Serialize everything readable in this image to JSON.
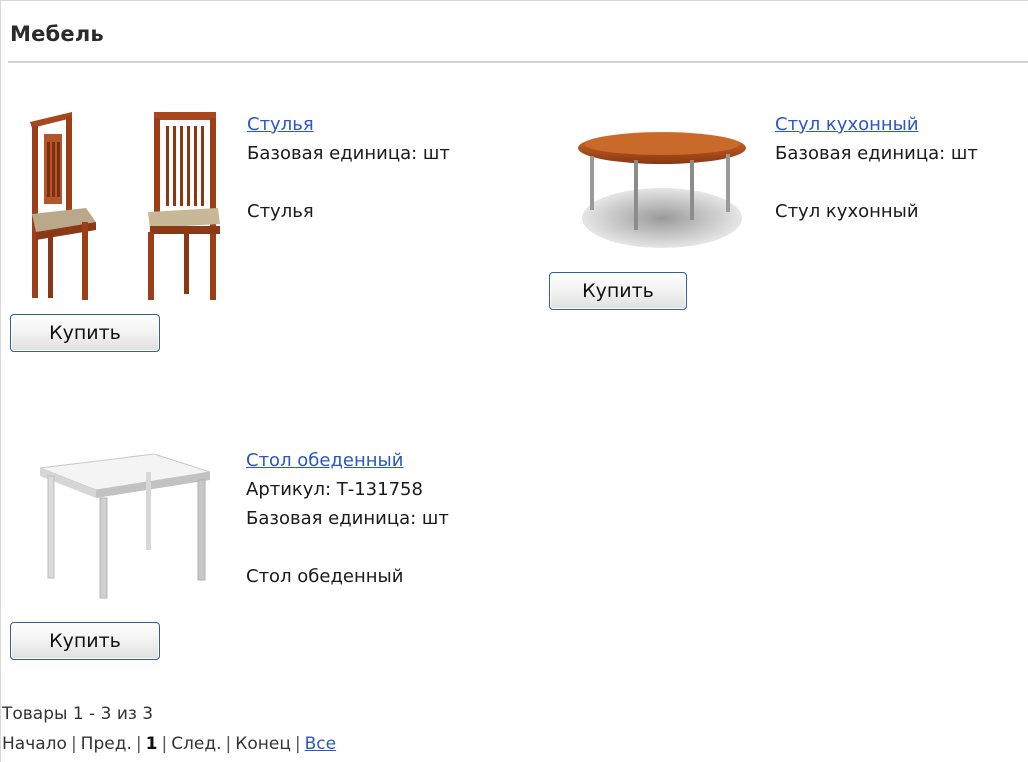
{
  "category": {
    "title": "Мебель"
  },
  "products": [
    {
      "name": "Стулья",
      "article": "",
      "unit": "Базовая единица: шт",
      "description": "Стулья",
      "buy_label": "Купить",
      "image": "chairs-image"
    },
    {
      "name": "Стул кухонный",
      "article": "",
      "unit": "Базовая единица: шт",
      "description": "Стул кухонный",
      "buy_label": "Купить",
      "image": "round-table-image"
    },
    {
      "name": "Стол обеденный",
      "article": "Артикул: Т-131758",
      "unit": "Базовая единица: шт",
      "description": "Стол обеденный",
      "buy_label": "Купить",
      "image": "dining-table-image"
    }
  ],
  "pager": {
    "summary": "Товары 1 - 3 из 3",
    "first": "Начало",
    "prev": "Пред.",
    "current": "1",
    "next": "След.",
    "last": "Конец",
    "all": "Все",
    "separator": "|"
  },
  "colors": {
    "link": "#2a56c6",
    "button_border": "#2c5fa3"
  }
}
